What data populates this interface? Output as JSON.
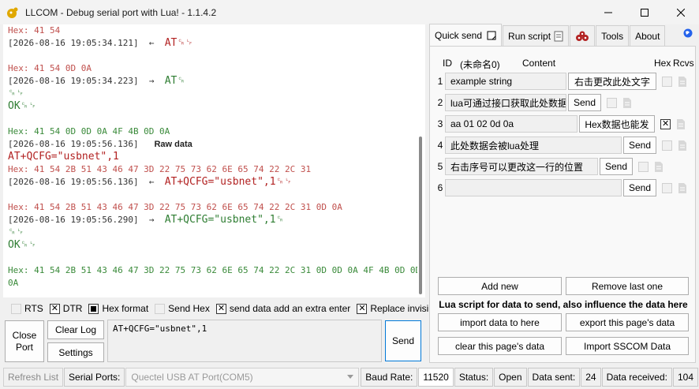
{
  "window": {
    "title": "LLCOM - Debug serial port with Lua! - 1.1.4.2"
  },
  "log": {
    "lines": [
      {
        "cls": "hex-rx",
        "text": "Hex: 41 54"
      },
      {
        "cls": "ts",
        "text": "[2026-08-16 19:05:34.121]  ←  ",
        "data": "AT␍␊",
        "dcls": "rx-data"
      },
      {
        "cls": "",
        "text": ""
      },
      {
        "cls": "hex-rx",
        "text": "Hex: 41 54 0D 0A"
      },
      {
        "cls": "ts",
        "text": "[2026-08-16 19:05:34.223]  →  ",
        "data": "AT␍",
        "dcls": "tx-data"
      },
      {
        "cls": "tx-data",
        "text": "␍␊"
      },
      {
        "cls": "tx-data",
        "text": "OK␍␊"
      },
      {
        "cls": "",
        "text": ""
      },
      {
        "cls": "hex-tx",
        "text": "Hex: 41 54 0D 0D 0A 4F 4B 0D 0A"
      },
      {
        "cls": "ts",
        "text": "[2026-08-16 19:05:56.136]   ",
        "data": "Raw data",
        "dcls": "rawtag"
      },
      {
        "cls": "rx-data",
        "text": "AT+QCFG=\"usbnet\",1"
      },
      {
        "cls": "hex-rx",
        "text": "Hex: 41 54 2B 51 43 46 47 3D 22 75 73 62 6E 65 74 22 2C 31"
      },
      {
        "cls": "ts",
        "text": "[2026-08-16 19:05:56.136]  ←  ",
        "data": "AT+QCFG=\"usbnet\",1␍␊",
        "dcls": "rx-data"
      },
      {
        "cls": "",
        "text": ""
      },
      {
        "cls": "hex-rx",
        "text": "Hex: 41 54 2B 51 43 46 47 3D 22 75 73 62 6E 65 74 22 2C 31 0D 0A"
      },
      {
        "cls": "ts",
        "text": "[2026-08-16 19:05:56.290]  →  ",
        "data": "AT+QCFG=\"usbnet\",1␍",
        "dcls": "tx-data"
      },
      {
        "cls": "tx-data",
        "text": "␍␊"
      },
      {
        "cls": "tx-data",
        "text": "OK␍␊"
      },
      {
        "cls": "",
        "text": ""
      },
      {
        "cls": "hex-tx",
        "text": "Hex: 41 54 2B 51 43 46 47 3D 22 75 73 62 6E 65 74 22 2C 31 0D 0D 0A 4F 4B 0D 0D"
      },
      {
        "cls": "hex-tx",
        "text": "0A"
      }
    ]
  },
  "options": {
    "rts": "RTS",
    "dtr": "DTR",
    "hex_format": "Hex format",
    "send_hex": "Send Hex",
    "extra_enter": "send data add an extra enter",
    "replace_invisible": "Replace invisi"
  },
  "buttons": {
    "close_port": "Close Port",
    "clear_log": "Clear Log",
    "settings": "Settings",
    "send": "Send"
  },
  "send_box": {
    "value": "AT+QCFG=\"usbnet\",1"
  },
  "statusbar": {
    "refresh_list": "Refresh List",
    "serial_ports_label": "Serial Ports:",
    "serial_port_value": "Quectel USB AT Port(COM5)",
    "baud_label": "Baud Rate:",
    "baud_value": "11520",
    "status_label": "Status:",
    "status_value": "Open",
    "sent_label": "Data sent:",
    "sent_value": "24",
    "received_label": "Data received:",
    "received_value": "104"
  },
  "tabs": [
    {
      "label": "Quick send"
    },
    {
      "label": "Run script"
    },
    {
      "label": ""
    },
    {
      "label": "Tools"
    },
    {
      "label": "About"
    }
  ],
  "quick_send": {
    "header_id": "ID",
    "header_unnamed": "(未命名0)",
    "header_content": "Content",
    "header_hex": "Hex",
    "header_rcvs": "Rcvs",
    "rows": [
      {
        "num": "1",
        "content": "example string",
        "button": "右击更改此处文字",
        "hex": false
      },
      {
        "num": "2",
        "content": "lua可通过接口获取此处数据",
        "button": "Send",
        "hex": false
      },
      {
        "num": "3",
        "content": "aa 01 02 0d 0a",
        "button": "Hex数据也能发",
        "hex": true
      },
      {
        "num": "4",
        "content": "此处数据会被lua处理",
        "button": "Send",
        "hex": false
      },
      {
        "num": "5",
        "content": "右击序号可以更改这一行的位置",
        "button": "Send",
        "hex": false
      },
      {
        "num": "6",
        "content": "",
        "button": "Send",
        "hex": false
      }
    ],
    "add_new": "Add new",
    "remove_last": "Remove last one",
    "lua_hint": "Lua script for data to send, also influence the data here",
    "import_data": "import data to here",
    "export_data": "export this page's data",
    "clear_page": "clear this page's data",
    "import_sscom": "Import SSCOM Data"
  }
}
